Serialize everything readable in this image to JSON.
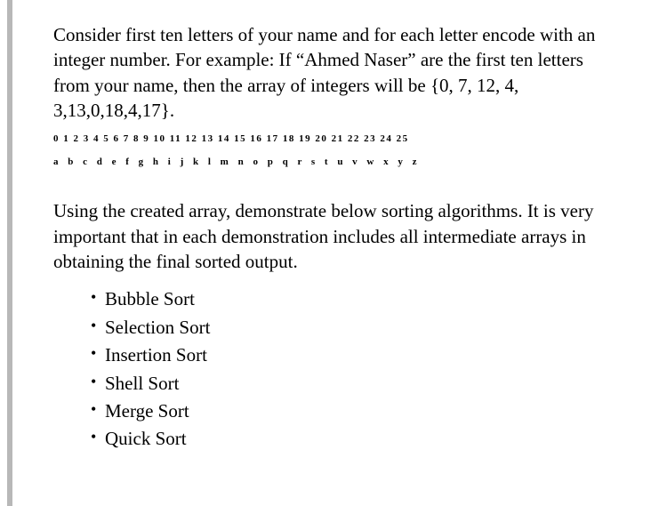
{
  "intro_paragraph": "Consider first ten letters of your name and for each letter encode with an integer number. For example:  If “Ahmed Naser” are the first ten letters from your name, then the array of integers will be {0, 7, 12, 4, 3,13,0,18,4,17}.",
  "number_mapping": "0 1 2 3 4 5 6 7 8 9 10 11 12 13 14 15 16 17 18 19 20 21 22 23 24 25",
  "letter_mapping": "a b c d e f g h i j k l m n o p q r s t u v w x y z",
  "task_paragraph": "Using the created array, demonstrate below sorting algorithms. It is very important that in each demonstration includes all intermediate arrays in obtaining the final sorted output.",
  "algorithms": [
    "Bubble Sort",
    "Selection Sort",
    "Insertion Sort",
    "Shell Sort",
    "Merge Sort",
    "Quick Sort"
  ]
}
